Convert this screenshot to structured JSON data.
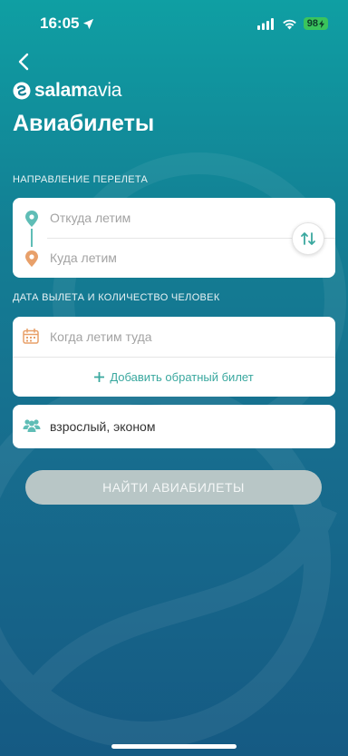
{
  "status_bar": {
    "time": "16:05",
    "battery": "98"
  },
  "header": {
    "logo_brand": "salam",
    "logo_suffix": "avia",
    "title": "Авиабилеты"
  },
  "route_section": {
    "label": "НАПРАВЛЕНИЕ ПЕРЕЛЕТА",
    "from_placeholder": "Откуда летим",
    "to_placeholder": "Куда летим"
  },
  "date_section": {
    "label": "ДАТА ВЫЛЕТА И КОЛИЧЕСТВО ЧЕЛОВЕК",
    "departure_placeholder": "Когда летим туда",
    "add_return_label": "Добавить обратный билет"
  },
  "passengers": {
    "value": "взрослый, эконом"
  },
  "search_button": {
    "label": "НАЙТИ АВИАБИЛЕТЫ"
  },
  "colors": {
    "accent_teal": "#3aa89f",
    "pin_from": "#5fbdb6",
    "pin_to": "#e8a06a",
    "button_disabled": "#b8c6c6"
  },
  "icons": {
    "back": "chevron-left-icon",
    "from": "location-pin-icon",
    "to": "location-pin-icon",
    "swap": "swap-arrows-icon",
    "calendar": "calendar-icon",
    "add": "plus-icon",
    "passengers": "people-icon"
  }
}
